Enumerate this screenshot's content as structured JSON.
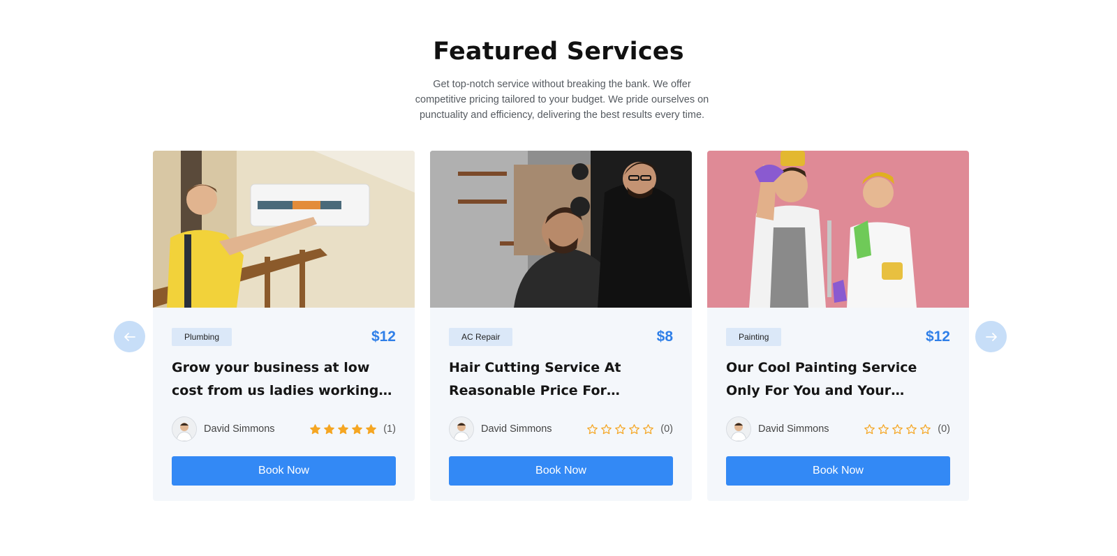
{
  "section": {
    "title": "Featured Services",
    "subtitle": "Get top-notch service without breaking the bank. We offer competitive pricing tailored to your budget. We pride ourselves on punctuality and efficiency, delivering the best results every time."
  },
  "navigation": {
    "prev_icon": "arrow-left-icon",
    "next_icon": "arrow-right-icon"
  },
  "colors": {
    "accent": "#3389f5",
    "price": "#2f7fe8",
    "star": "#f5a623",
    "card_bg": "#f4f7fb",
    "badge_bg": "#dbe8f8",
    "arrow_bg": "#c7def8"
  },
  "services": [
    {
      "category": "Plumbing",
      "price": "$12",
      "title": "Grow your business at low cost from us ladies working as team",
      "author": "David Simmons",
      "rating": 5,
      "rating_count": "(1)",
      "button": "Book Now",
      "image": "technician-installing-air-conditioner-photo"
    },
    {
      "category": "AC Repair",
      "price": "$8",
      "title": "Hair Cutting Service At Reasonable Price For Handsome Men",
      "author": "David Simmons",
      "rating": 0,
      "rating_count": "(0)",
      "button": "Book Now",
      "image": "barber-cutting-hair-photo"
    },
    {
      "category": "Painting",
      "price": "$12",
      "title": "Our Cool Painting Service Only For You and Your Colorfull Home",
      "author": "David Simmons",
      "rating": 0,
      "rating_count": "(0)",
      "button": "Book Now",
      "image": "couple-cleaning-pink-background-photo"
    }
  ]
}
